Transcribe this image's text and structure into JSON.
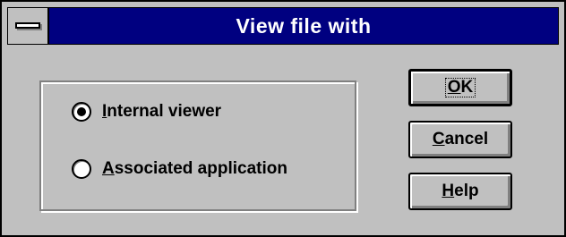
{
  "dialog": {
    "title": "View file with",
    "system_menu": "system-menu-icon"
  },
  "options": [
    {
      "mnemonic": "I",
      "rest": "nternal viewer",
      "checked": true
    },
    {
      "mnemonic": "A",
      "rest": "ssociated application",
      "checked": false
    }
  ],
  "buttons": {
    "ok": {
      "mnemonic": "O",
      "rest": "K"
    },
    "cancel": {
      "mnemonic": "C",
      "rest": "ancel"
    },
    "help": {
      "mnemonic": "H",
      "rest": "elp"
    }
  }
}
